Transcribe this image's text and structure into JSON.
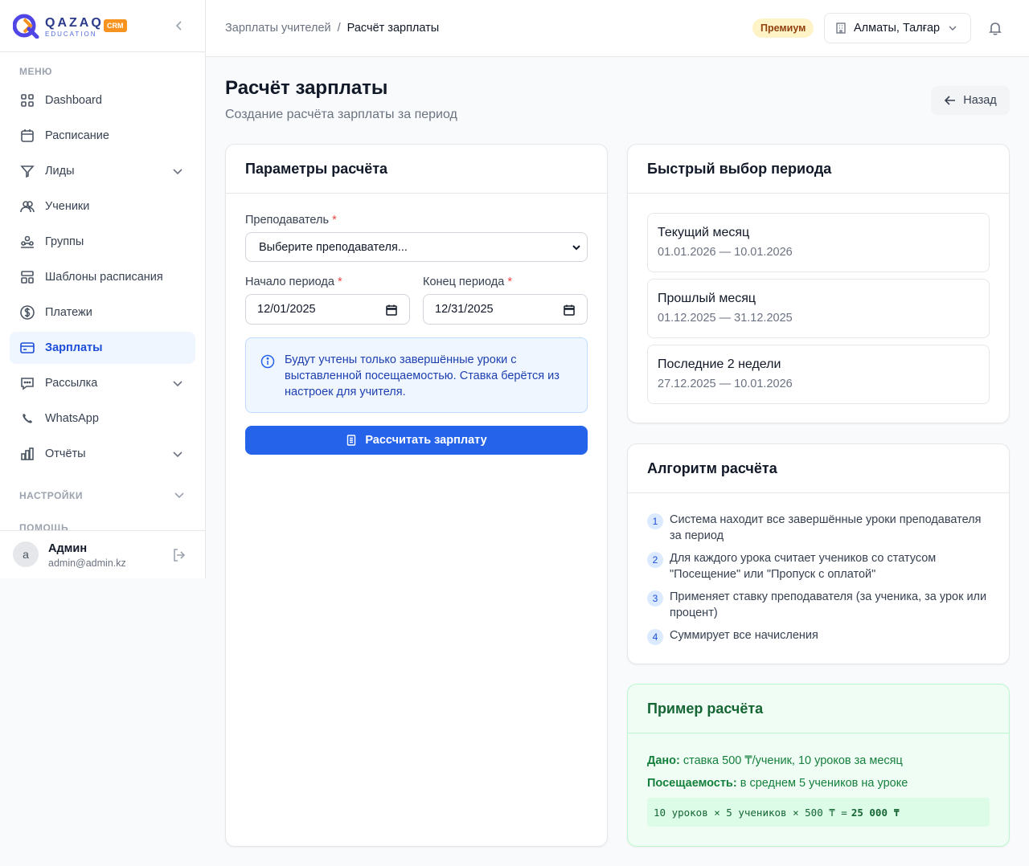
{
  "brand": {
    "name": "QAZAQ",
    "sub": "EDUCATION",
    "badge": "CRM"
  },
  "sidebar": {
    "menu_label": "МЕНЮ",
    "items": [
      {
        "label": "Dashboard",
        "icon": "grid-icon"
      },
      {
        "label": "Расписание",
        "icon": "calendar-icon"
      },
      {
        "label": "Лиды",
        "icon": "filter-icon",
        "expandable": true
      },
      {
        "label": "Ученики",
        "icon": "users-icon"
      },
      {
        "label": "Группы",
        "icon": "group-icon"
      },
      {
        "label": "Шаблоны расписания",
        "icon": "template-icon"
      },
      {
        "label": "Платежи",
        "icon": "dollar-icon"
      },
      {
        "label": "Зарплаты",
        "icon": "card-icon",
        "active": true
      },
      {
        "label": "Рассылка",
        "icon": "message-icon",
        "expandable": true
      },
      {
        "label": "WhatsApp",
        "icon": "phone-icon"
      },
      {
        "label": "Отчёты",
        "icon": "chart-icon",
        "expandable": true
      }
    ],
    "settings_label": "НАСТРОЙКИ",
    "help_label": "ПОМОЩЬ"
  },
  "user": {
    "initial": "a",
    "name": "Админ",
    "email": "admin@admin.kz"
  },
  "header": {
    "breadcrumb_parent": "Зарплаты учителей",
    "breadcrumb_sep": "/",
    "breadcrumb_current": "Расчёт зарплаты",
    "premium": "Премиум",
    "branch": "Алматы, Талғар"
  },
  "page": {
    "title": "Расчёт зарплаты",
    "subtitle": "Создание расчёта зарплаты за период",
    "back": "Назад"
  },
  "params": {
    "title": "Параметры расчёта",
    "teacher_label": "Преподаватель",
    "teacher_placeholder": "Выберите преподавателя...",
    "start_label": "Начало периода",
    "start_value": "12/01/2025",
    "end_label": "Конец периода",
    "end_value": "12/31/2025",
    "required_mark": "*",
    "info": "Будут учтены только завершённые уроки с выставленной посещаемостью. Ставка берётся из настроек для учителя.",
    "button": "Рассчитать зарплату"
  },
  "quick": {
    "title": "Быстрый выбор периода",
    "periods": [
      {
        "title": "Текущий месяц",
        "range": "01.01.2026 — 10.01.2026"
      },
      {
        "title": "Прошлый месяц",
        "range": "01.12.2025 — 31.12.2025"
      },
      {
        "title": "Последние 2 недели",
        "range": "27.12.2025 — 10.01.2026"
      }
    ]
  },
  "algorithm": {
    "title": "Алгоритм расчёта",
    "steps": [
      {
        "n": "1",
        "text": "Система находит все завершённые уроки преподавателя за период"
      },
      {
        "n": "2",
        "text": "Для каждого урока считает учеников со статусом \"Посещение\" или \"Пропуск с оплатой\""
      },
      {
        "n": "3",
        "text": "Применяет ставку преподавателя (за ученика, за урок или процент)"
      },
      {
        "n": "4",
        "text": "Суммирует все начисления"
      }
    ]
  },
  "example": {
    "title": "Пример расчёта",
    "given_label": "Дано:",
    "given_text": "ставка 500 ₸/ученик, 10 уроков за месяц",
    "attendance_label": "Посещаемость:",
    "attendance_text": "в среднем 5 учеников на уроке",
    "formula": "10 уроков × 5 учеников × 500 ₸ =",
    "result": "25 000 ₸"
  },
  "colors": {
    "primary": "#2563eb",
    "active_bg": "#eff6ff",
    "premium_bg": "#fef3c7",
    "example_bg": "#f0fdf4",
    "brand_orange": "#f7931e"
  }
}
